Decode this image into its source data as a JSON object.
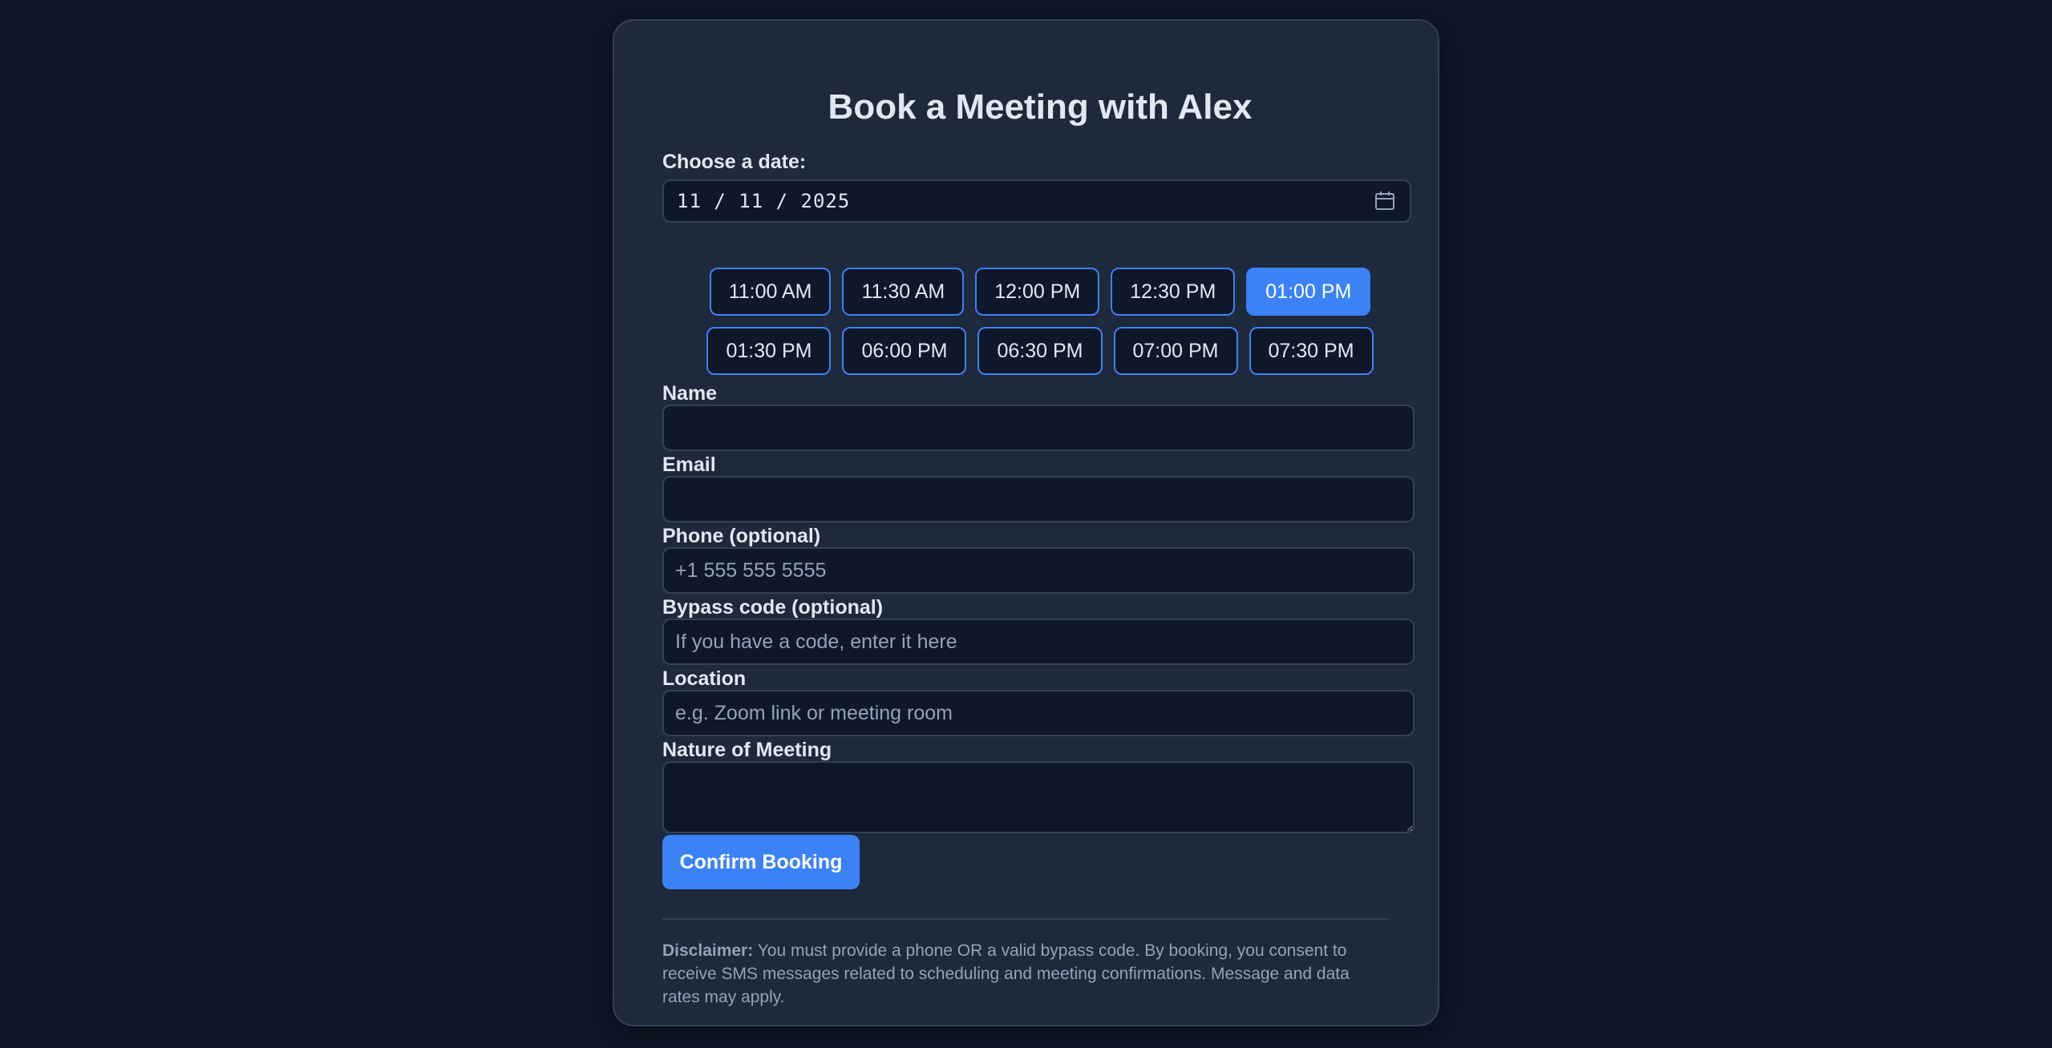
{
  "page": {
    "title": "Book a Meeting with Alex"
  },
  "date": {
    "label": "Choose a date:",
    "value": "11 / 11 / 2025",
    "icon": "calendar-icon"
  },
  "time_slots": {
    "row1": [
      "11:00 AM",
      "11:30 AM",
      "12:00 PM",
      "12:30 PM",
      "01:00 PM"
    ],
    "row2": [
      "01:30 PM",
      "06:00 PM",
      "06:30 PM",
      "07:00 PM",
      "07:30 PM"
    ],
    "selected": "01:00 PM"
  },
  "form": {
    "name": {
      "label": "Name",
      "value": "",
      "placeholder": ""
    },
    "email": {
      "label": "Email",
      "value": "",
      "placeholder": ""
    },
    "phone": {
      "label": "Phone (optional)",
      "value": "",
      "placeholder": "+1 555 555 5555"
    },
    "bypass": {
      "label": "Bypass code (optional)",
      "value": "",
      "placeholder": "If you have a code, enter it here"
    },
    "location": {
      "label": "Location",
      "value": "",
      "placeholder": "e.g. Zoom link or meeting room"
    },
    "nature": {
      "label": "Nature of Meeting",
      "value": "",
      "placeholder": ""
    },
    "submit_label": "Confirm Booking"
  },
  "disclaimer": {
    "heading": "Disclaimer:",
    "text": " You must provide a phone OR a valid bypass code. By booking, you consent to receive SMS messages related to scheduling and meeting confirmations. Message and data rates may apply."
  },
  "colors": {
    "background": "#0f172a",
    "card": "#1e293b",
    "accent": "#3b82f6",
    "text": "#e2e8f0",
    "muted": "#94a3b8"
  }
}
